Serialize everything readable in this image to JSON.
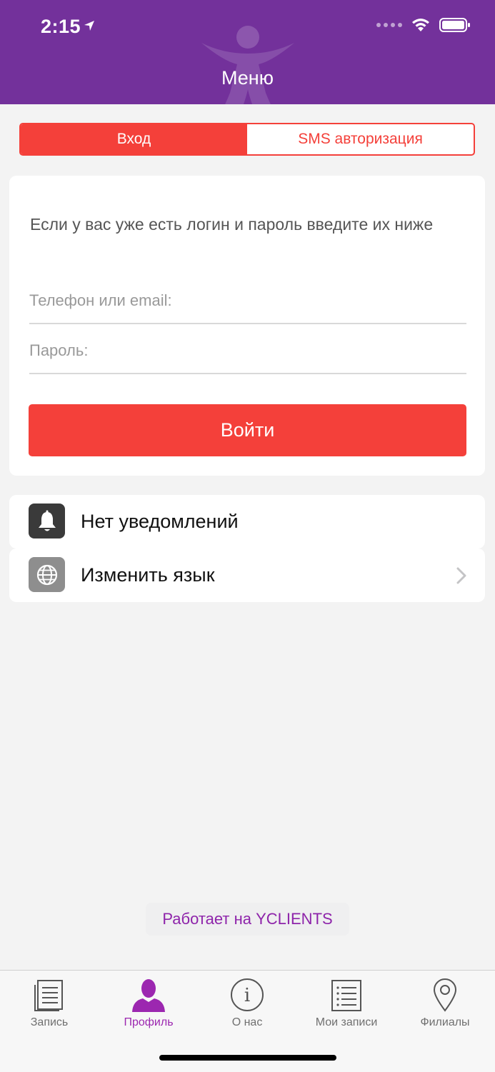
{
  "status_bar": {
    "time": "2:15"
  },
  "header": {
    "title": "Меню"
  },
  "tabs_segment": [
    {
      "label": "Вход",
      "active": true
    },
    {
      "label": "SMS авторизация",
      "active": false
    }
  ],
  "login": {
    "intro": "Если у вас уже есть логин и пароль введите их ниже",
    "phone_placeholder": "Телефон или email:",
    "password_placeholder": "Пароль:",
    "submit_label": "Войти"
  },
  "menu": {
    "notifications_label": "Нет уведомлений",
    "language_label": "Изменить язык"
  },
  "powered_by": "Работает на YCLIENTS",
  "tabbar": [
    {
      "label": "Запись",
      "icon": "document-icon",
      "active": false
    },
    {
      "label": "Профиль",
      "icon": "person-icon",
      "active": true
    },
    {
      "label": "О нас",
      "icon": "info-icon",
      "active": false
    },
    {
      "label": "Мои записи",
      "icon": "list-icon",
      "active": false
    },
    {
      "label": "Филиалы",
      "icon": "map-pin-icon",
      "active": false
    }
  ],
  "colors": {
    "header": "#73319b",
    "accent": "#f4403a",
    "tab_active": "#9c27b0",
    "powered_text": "#8e24aa"
  }
}
